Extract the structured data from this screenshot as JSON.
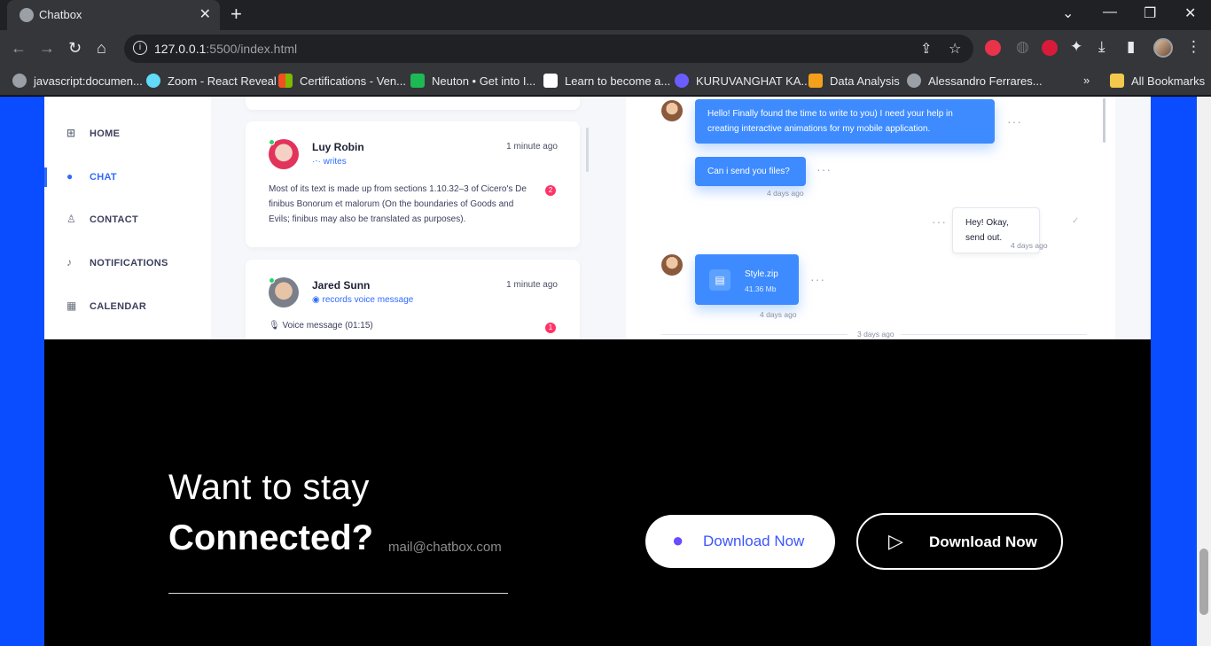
{
  "browser": {
    "tab_title": "Chatbox",
    "url_host": "127.0.0.1",
    "url_rest": ":5500/index.html",
    "bookmarks": [
      "javascript:documen...",
      "Zoom - React Reveal",
      "Certifications - Ven...",
      "Neuton • Get into I...",
      "Learn to become a...",
      "KURUVANGHAT KA...",
      "Data Analysis",
      "Alessandro Ferrares..."
    ],
    "all_bookmarks": "All Bookmarks",
    "overflow": "»"
  },
  "sidebar": {
    "items": [
      {
        "label": "HOME",
        "icon": "grid-icon"
      },
      {
        "label": "CHAT",
        "icon": "chat-icon"
      },
      {
        "label": "CONTACT",
        "icon": "user-icon"
      },
      {
        "label": "NOTIFICATIONS",
        "icon": "bell-icon"
      },
      {
        "label": "CALENDAR",
        "icon": "calendar-icon"
      }
    ]
  },
  "chat_list": [
    {
      "name": "Luy Robin",
      "status": "writes",
      "time": "1 minute ago",
      "message": "Most of its text is made up from sections 1.10.32–3 of Cicero's De finibus Bonorum et malorum (On the boundaries of Goods and Evils; finibus may also be translated as purposes).",
      "badge": "2"
    },
    {
      "name": "Jared Sunn",
      "status": "records voice message",
      "time": "1 minute ago",
      "message": "Voice message (01:15)",
      "badge": "1"
    }
  ],
  "conversation": {
    "msg1": "Hello! Finally found the time to write to you) I need your help in creating interactive animations for my mobile application.",
    "msg2": "Can i send you files?",
    "msg2_time": "4 days ago",
    "reply": "Hey! Okay, send out.",
    "reply_time": "4 days ago",
    "file_name": "Style.zip",
    "file_size": "41.36 Mb",
    "file_time": "4 days ago",
    "divider": "3 days ago",
    "dots": "···"
  },
  "footer": {
    "line1": "Want to stay",
    "line2": "Connected?",
    "email": "mail@chatbox.com",
    "apple_button": "Download Now",
    "play_button": "Download Now"
  },
  "colors": {
    "page_bg": "#0a4cff",
    "accent": "#2f6bff",
    "bubble": "#3d8bff",
    "badge": "#ff3366"
  }
}
